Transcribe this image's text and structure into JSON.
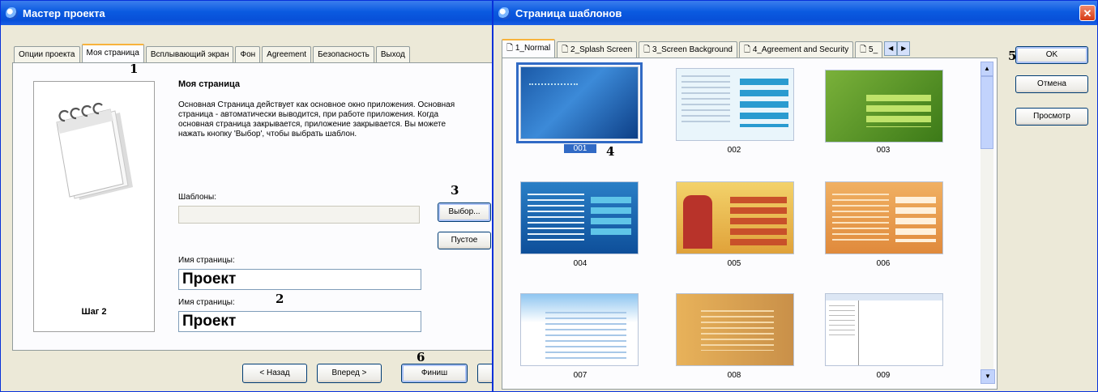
{
  "wizard": {
    "title": "Мастер проекта",
    "tabs": [
      "Опции проекта",
      "Моя страница",
      "Всплывающий экран",
      "Фон",
      "Agreement",
      "Безопасность",
      "Выход"
    ],
    "step": "Шаг 2",
    "heading": "Моя страница",
    "description": "Основная Страница действует как основное окно приложения. Основная страница - автоматически выводится, при работе приложения. Когда основная страница закрывается, приложение закрывается. Вы можете нажать кнопку 'Выбор', чтобы выбрать шаблон.",
    "templates_label": "Шаблоны:",
    "select_btn": "Выбор...",
    "empty_btn": "Пустое",
    "page_name_label_1": "Имя страницы:",
    "page_name_value_1": "Проект",
    "page_name_label_2": "Имя страницы:",
    "page_name_value_2": "Проект",
    "back_btn": "< Назад",
    "next_btn": "Вперед >",
    "finish_btn": "Финиш"
  },
  "templates": {
    "title": "Страница шаблонов",
    "tabs": [
      "1_Normal",
      "2_Splash Screen",
      "3_Screen Background",
      "4_Agreement and Security",
      "5_"
    ],
    "items": [
      "001",
      "002",
      "003",
      "004",
      "005",
      "006",
      "007",
      "008",
      "009"
    ],
    "ok_btn": "OK",
    "cancel_btn": "Отмена",
    "preview_btn": "Просмотр"
  },
  "markers": [
    "1",
    "2",
    "3",
    "4",
    "5",
    "6"
  ]
}
